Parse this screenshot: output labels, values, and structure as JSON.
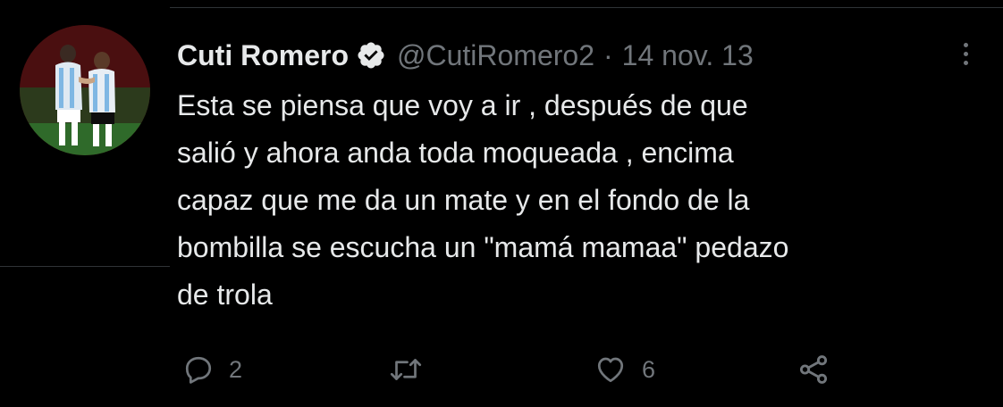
{
  "tweet": {
    "display_name": "Cuti Romero",
    "verified": true,
    "handle": "@CutiRomero2",
    "separator": "·",
    "date": "14 nov. 13",
    "text": "Esta se piensa que voy a ir , después de que\nsalió y ahora anda toda moqueada , encima\ncapaz que me da un mate y en el fondo de la\nbombilla se escucha un \"mamá mamaa\" pedazo\nde trola",
    "avatar_icon": "avatar-photo-two-players"
  },
  "actions": {
    "reply": {
      "icon": "reply-icon",
      "count": "2"
    },
    "retweet": {
      "icon": "retweet-icon",
      "count": ""
    },
    "like": {
      "icon": "heart-icon",
      "count": "6"
    },
    "share": {
      "icon": "share-icon"
    }
  },
  "colors": {
    "background": "#000000",
    "text_primary": "#e7e9ea",
    "text_secondary": "#71767b",
    "divider": "#2f3336",
    "verified_badge": "#e7e9ea"
  }
}
